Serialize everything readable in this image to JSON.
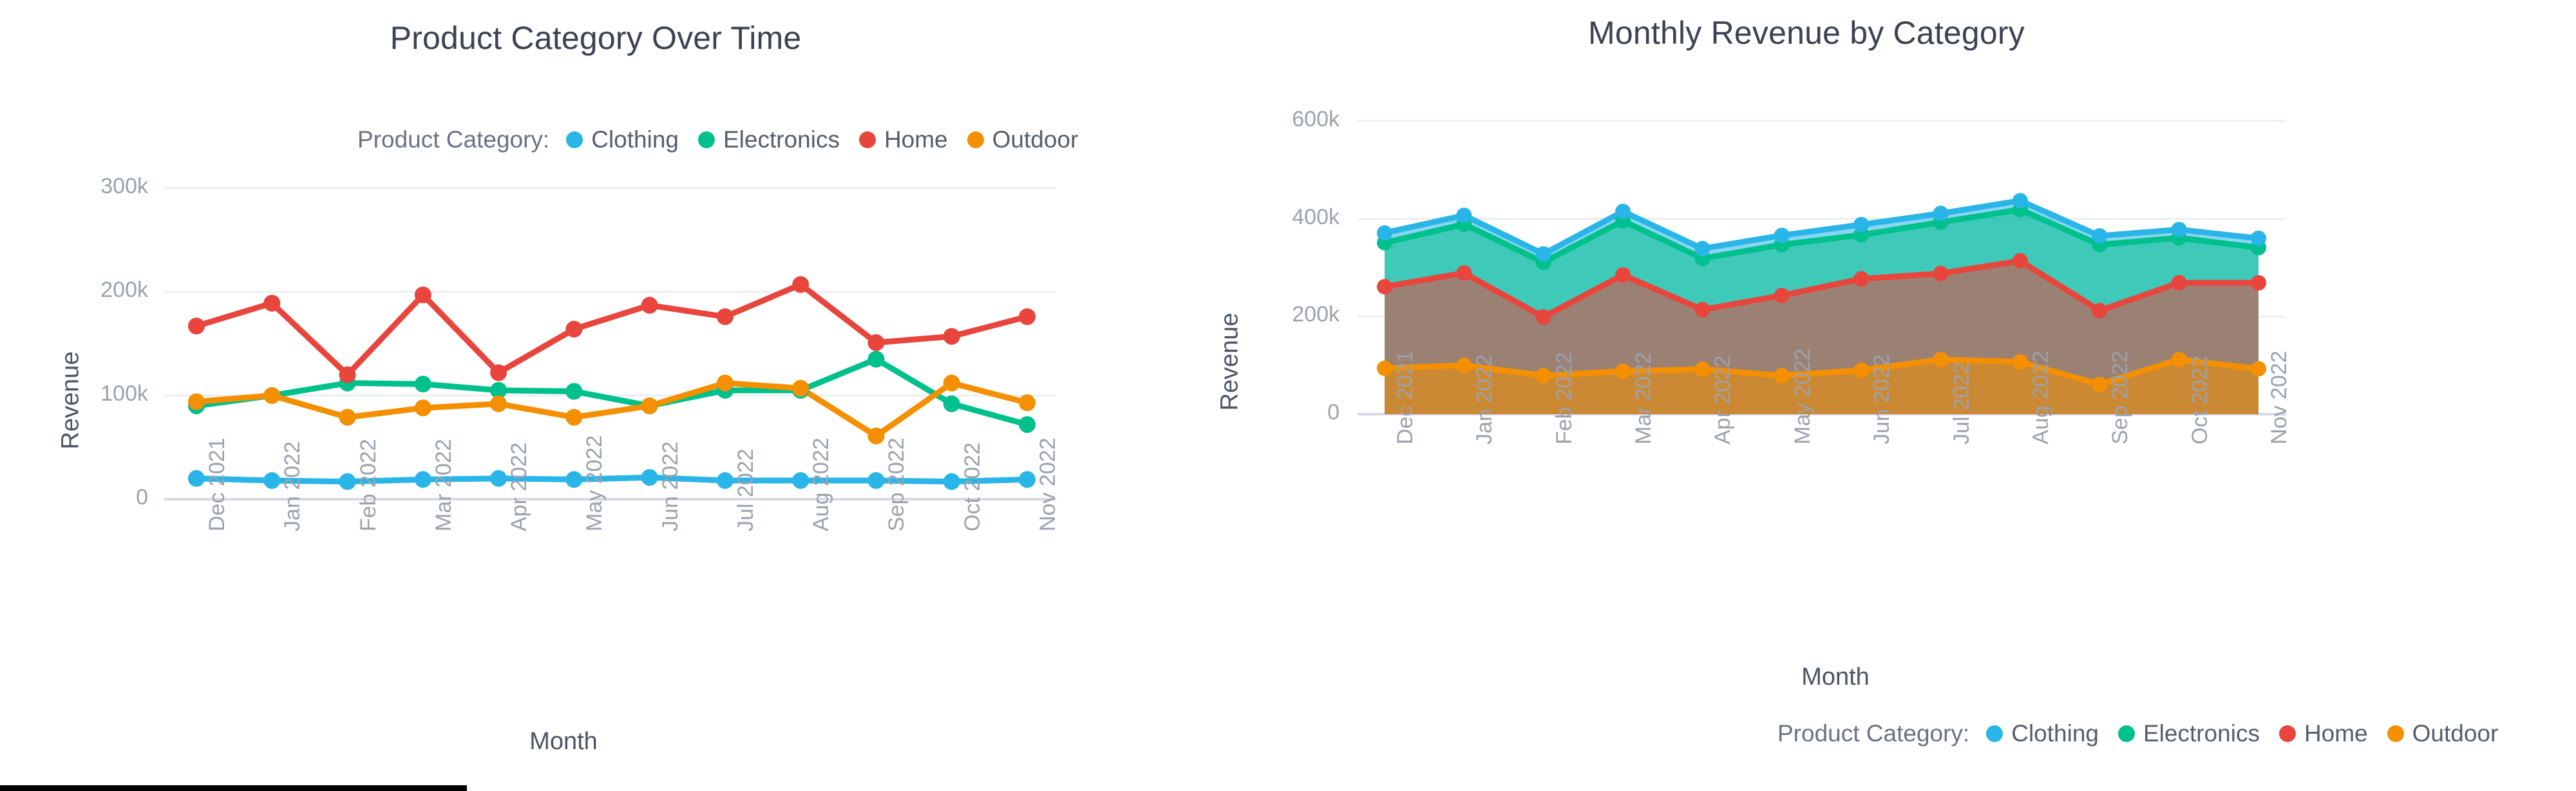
{
  "legend": {
    "label": "Product Category:",
    "items": [
      {
        "name": "Clothing",
        "color": "#29b5e8"
      },
      {
        "name": "Electronics",
        "color": "#00c08b"
      },
      {
        "name": "Home",
        "color": "#e8453c"
      },
      {
        "name": "Outdoor",
        "color": "#f49000"
      }
    ]
  },
  "left_chart": {
    "title": "Product Category Over Time",
    "xlabel": "Month",
    "ylabel": "Revenue"
  },
  "right_chart": {
    "title": "Monthly Revenue by Category",
    "xlabel": "Month",
    "ylabel": "Revenue"
  },
  "chart_data": [
    {
      "type": "line",
      "title": "Product Category Over Time",
      "xlabel": "Month",
      "ylabel": "Revenue",
      "categories": [
        "Dec 2021",
        "Jan 2022",
        "Feb 2022",
        "Mar 2022",
        "Apr 2022",
        "May 2022",
        "Jun 2022",
        "Jul 2022",
        "Aug 2022",
        "Sep 2022",
        "Oct 2022",
        "Nov 2022"
      ],
      "ylim": [
        0,
        300000
      ],
      "yticks": [
        0,
        100000,
        200000,
        300000
      ],
      "ytick_labels": [
        "0",
        "100k",
        "200k",
        "300k"
      ],
      "grid": true,
      "legend_position": "top",
      "series": [
        {
          "name": "Clothing",
          "color": "#29b5e8",
          "values": [
            20000,
            18000,
            17000,
            19000,
            20000,
            19000,
            21000,
            18000,
            18000,
            18000,
            17000,
            19000
          ]
        },
        {
          "name": "Electronics",
          "color": "#00c08b",
          "values": [
            90000,
            100000,
            112000,
            111000,
            105000,
            104000,
            90000,
            105000,
            105000,
            135000,
            92000,
            72000
          ]
        },
        {
          "name": "Home",
          "color": "#e8453c",
          "values": [
            167000,
            189000,
            120000,
            197000,
            122000,
            164000,
            187000,
            176000,
            207000,
            151000,
            157000,
            176000
          ]
        },
        {
          "name": "Outdoor",
          "color": "#f49000",
          "values": [
            94000,
            100000,
            79000,
            88000,
            92000,
            79000,
            90000,
            112000,
            107000,
            61000,
            112000,
            93000
          ]
        }
      ]
    },
    {
      "type": "area",
      "title": "Monthly Revenue by Category",
      "xlabel": "Month",
      "ylabel": "Revenue",
      "categories": [
        "Dec 2021",
        "Jan 2022",
        "Feb 2022",
        "Mar 2022",
        "Apr 2022",
        "May 2022",
        "Jun 2022",
        "Jul 2022",
        "Aug 2022",
        "Sep 2022",
        "Oct 2022",
        "Nov 2022"
      ],
      "ylim": [
        0,
        600000
      ],
      "yticks": [
        0,
        200000,
        400000,
        600000
      ],
      "ytick_labels": [
        "0",
        "200k",
        "400k",
        "600k"
      ],
      "grid": true,
      "legend_position": "bottom",
      "stacked": true,
      "stack_order": [
        "Outdoor",
        "Home",
        "Electronics",
        "Clothing"
      ],
      "series": [
        {
          "name": "Outdoor",
          "color": "#f49000",
          "values": [
            94000,
            100000,
            79000,
            88000,
            92000,
            79000,
            90000,
            112000,
            107000,
            61000,
            112000,
            93000
          ],
          "cumulative": [
            94000,
            100000,
            79000,
            88000,
            92000,
            79000,
            90000,
            112000,
            107000,
            61000,
            112000,
            93000
          ]
        },
        {
          "name": "Home",
          "color": "#e8453c",
          "values": [
            167000,
            189000,
            120000,
            197000,
            122000,
            164000,
            187000,
            176000,
            207000,
            151000,
            157000,
            176000
          ],
          "cumulative": [
            261000,
            289000,
            199000,
            285000,
            214000,
            243000,
            277000,
            288000,
            314000,
            212000,
            269000,
            269000
          ]
        },
        {
          "name": "Electronics",
          "color": "#00c08b",
          "values": [
            90000,
            100000,
            112000,
            111000,
            105000,
            104000,
            90000,
            105000,
            105000,
            135000,
            92000,
            72000
          ],
          "cumulative": [
            351000,
            389000,
            311000,
            396000,
            319000,
            347000,
            367000,
            393000,
            419000,
            347000,
            361000,
            341000
          ]
        },
        {
          "name": "Clothing",
          "color": "#29b5e8",
          "values": [
            20000,
            18000,
            17000,
            19000,
            20000,
            19000,
            21000,
            18000,
            18000,
            18000,
            17000,
            19000
          ],
          "cumulative": [
            371000,
            407000,
            328000,
            415000,
            339000,
            366000,
            388000,
            411000,
            437000,
            365000,
            378000,
            360000
          ]
        }
      ]
    }
  ]
}
